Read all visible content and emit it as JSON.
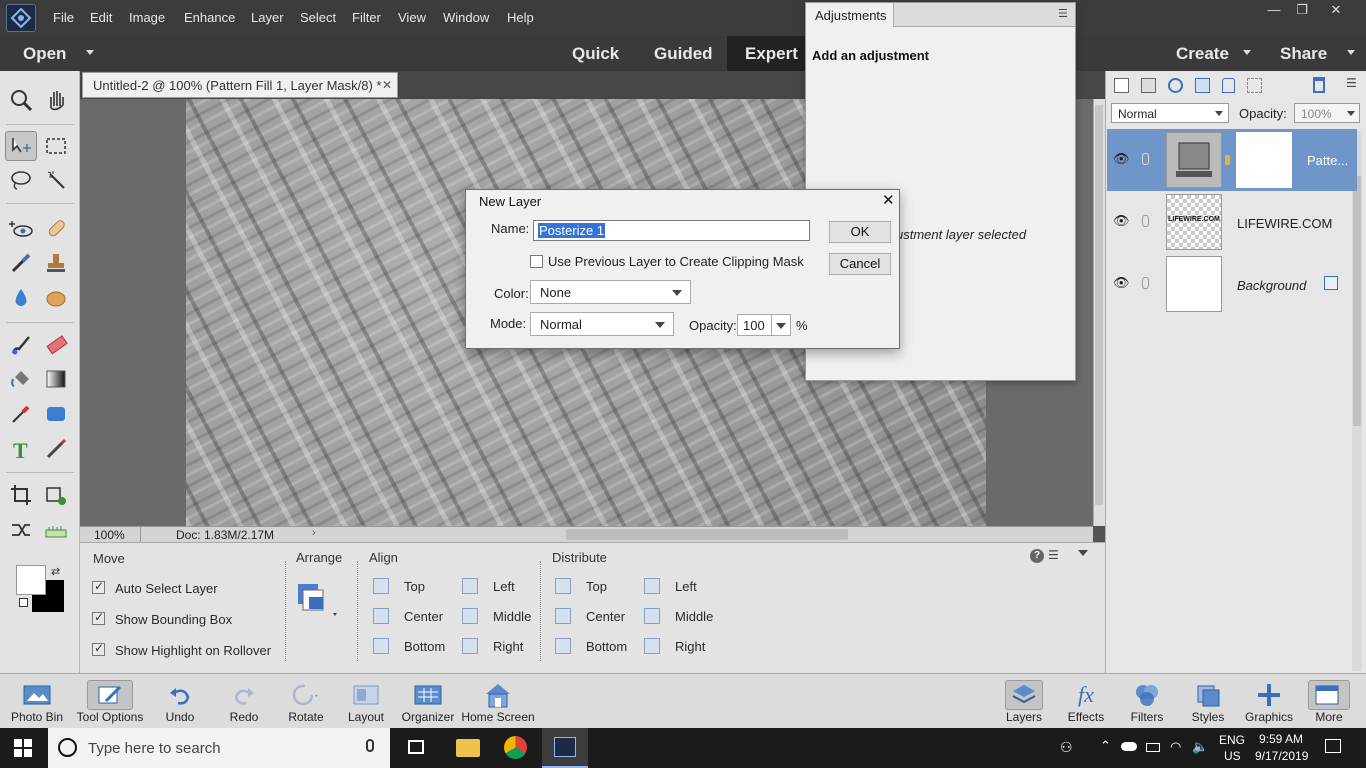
{
  "menubar": {
    "items": [
      "File",
      "Edit",
      "Image",
      "Enhance",
      "Layer",
      "Select",
      "Filter",
      "View",
      "Window",
      "Help"
    ],
    "window_controls": {
      "minimize": "—",
      "restore": "❐",
      "close": "✕"
    }
  },
  "modebar": {
    "open_label": "Open",
    "modes": [
      "Quick",
      "Guided",
      "Expert"
    ],
    "create_label": "Create",
    "share_label": "Share"
  },
  "document": {
    "tab_title": "Untitled-2 @ 100% (Pattern Fill 1, Layer Mask/8) *",
    "zoom": "100%",
    "doc_size": "Doc: 1.83M/2.17M"
  },
  "adjustments": {
    "tab_label": "Adjustments",
    "heading": "Add an adjustment",
    "status_text": "ustment layer selected"
  },
  "dialog": {
    "title": "New Layer",
    "name_label": "Name:",
    "name_value": "Posterize 1",
    "clip_label": "Use Previous Layer to Create Clipping Mask",
    "color_label": "Color:",
    "color_value": "None",
    "mode_label": "Mode:",
    "mode_value": "Normal",
    "opacity_label": "Opacity:",
    "opacity_value": "100",
    "percent": "%",
    "ok_label": "OK",
    "cancel_label": "Cancel"
  },
  "tool_options": {
    "move_heading": "Move",
    "checkboxes": [
      "Auto Select Layer",
      "Show Bounding Box",
      "Show Highlight on Rollover"
    ],
    "arrange_heading": "Arrange",
    "align_heading": "Align",
    "align_items": [
      "Top",
      "Center",
      "Bottom",
      "Left",
      "Middle",
      "Right"
    ],
    "distribute_heading": "Distribute",
    "distribute_items": [
      "Top",
      "Center",
      "Bottom",
      "Left",
      "Middle",
      "Right"
    ]
  },
  "layers": {
    "blend_mode": "Normal",
    "opacity_label": "Opacity:",
    "opacity_value": "100%",
    "items": [
      {
        "name": "Patte...",
        "selected": true
      },
      {
        "name": "LIFEWIRE.COM",
        "selected": false
      },
      {
        "name": "Background",
        "selected": false
      }
    ],
    "lifewire_thumb_text": "LIFEWIRE.COM"
  },
  "bottombar": {
    "left_items": [
      "Photo Bin",
      "Tool Options",
      "Undo",
      "Redo",
      "Rotate",
      "Layout",
      "Organizer",
      "Home Screen"
    ],
    "right_items": [
      "Layers",
      "Effects",
      "Filters",
      "Styles",
      "Graphics",
      "More"
    ]
  },
  "taskbar": {
    "search_placeholder": "Type here to search",
    "lang": "ENG",
    "region": "US",
    "time": "9:59 AM",
    "date": "9/17/2019"
  },
  "colors": {
    "accent": "#5b8bc9",
    "selected_layer": "#6f95c9",
    "menubar": "#3c3c3c",
    "panel": "#e3e3e3"
  }
}
